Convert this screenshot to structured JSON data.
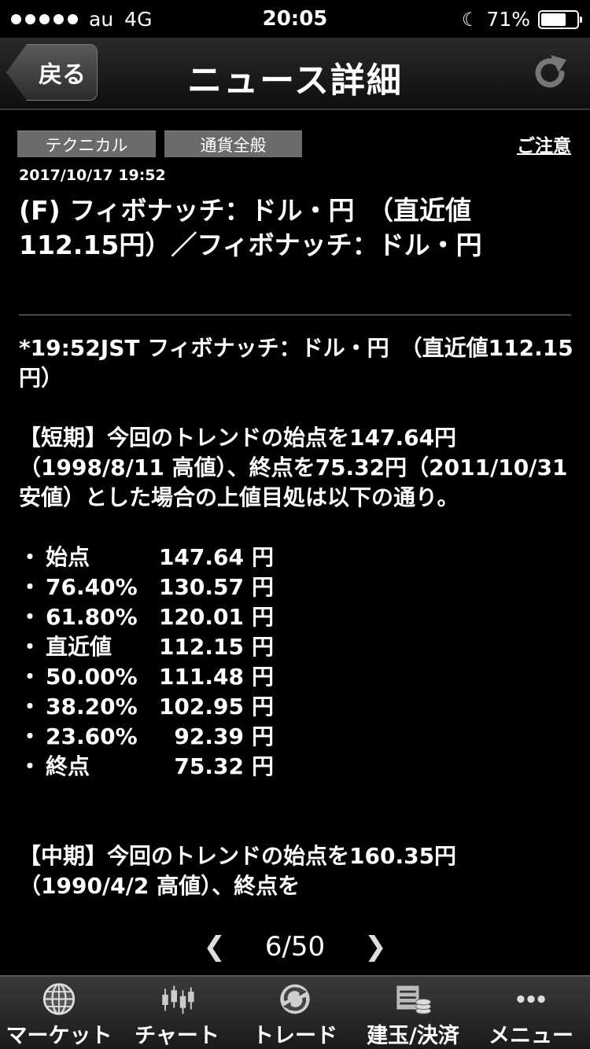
{
  "status_bar": {
    "carrier": "au",
    "network": "4G",
    "time": "20:05",
    "battery": "71%",
    "battery_level": 0.71
  },
  "nav": {
    "back_label": "戻る",
    "title": "ニュース詳細"
  },
  "article": {
    "tags": [
      "テクニカル",
      "通貨全般"
    ],
    "notice_link": "ご注意",
    "date": "2017/10/17 19:52",
    "headline": "(F) フィボナッチ：ドル・円　（直近値112.15円）／フィボナッチ：ドル・円",
    "lead": "*19:52JST フィボナッチ：ドル・円　（直近値112.15円）",
    "short_term": "【短期】今回のトレンドの始点を147.64円（1998/8/11 高値）、終点を75.32円（2011/10/31 安値）とした場合の上値目処は以下の通り。",
    "levels": [
      {
        "label": "始点",
        "value": "147.64",
        "unit": "円"
      },
      {
        "label": "76.40%",
        "value": "130.57",
        "unit": "円"
      },
      {
        "label": "61.80%",
        "value": "120.01",
        "unit": "円"
      },
      {
        "label": "直近値",
        "value": "112.15",
        "unit": "円"
      },
      {
        "label": "50.00%",
        "value": "111.48",
        "unit": "円"
      },
      {
        "label": "38.20%",
        "value": "102.95",
        "unit": "円"
      },
      {
        "label": "23.60%",
        "value": "92.39",
        "unit": "円"
      },
      {
        "label": "終点",
        "value": "75.32",
        "unit": "円"
      }
    ],
    "mid_term": "【中期】今回のトレンドの始点を160.35円（1990/4/2 高値）、終点を"
  },
  "pager": {
    "text": "6/50"
  },
  "tabs": [
    {
      "label": "マーケット",
      "icon": "globe-icon"
    },
    {
      "label": "チャート",
      "icon": "candlestick-chart-icon"
    },
    {
      "label": "トレード",
      "icon": "trade-exchange-icon"
    },
    {
      "label": "建玉/決済",
      "icon": "position-coins-icon"
    },
    {
      "label": "メニュー",
      "icon": "more-dots-icon"
    }
  ]
}
